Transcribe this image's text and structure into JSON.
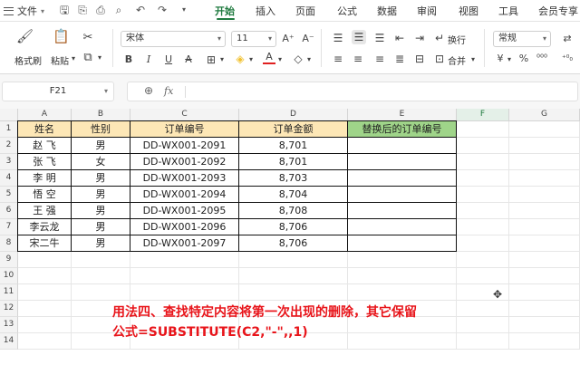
{
  "menubar": {
    "file_label": "文件",
    "tabs": [
      {
        "label": "开始",
        "active": true
      },
      {
        "label": "插入",
        "active": false
      },
      {
        "label": "页面",
        "active": false
      },
      {
        "label": "公式",
        "active": false
      },
      {
        "label": "数据",
        "active": false
      },
      {
        "label": "审阅",
        "active": false
      },
      {
        "label": "视图",
        "active": false
      },
      {
        "label": "工具",
        "active": false
      },
      {
        "label": "会员专享",
        "active": false
      }
    ],
    "accent_color": "#1f7a3f"
  },
  "ribbon": {
    "format_painter_label": "格式刷",
    "paste_label": "粘贴",
    "font_name": "宋体",
    "font_size": "11",
    "wrap_label": "换行",
    "merge_label": "合并",
    "number_format": "常规"
  },
  "formula_bar": {
    "name_box": "F21",
    "fx_label": "fx",
    "formula": ""
  },
  "sheet": {
    "columns": [
      "A",
      "B",
      "C",
      "D",
      "E",
      "F",
      "G"
    ],
    "selected_column": "F",
    "rows": [
      "1",
      "2",
      "3",
      "4",
      "5",
      "6",
      "7",
      "8",
      "9",
      "10",
      "11",
      "12",
      "13",
      "14"
    ],
    "table_headers": [
      "姓名",
      "性别",
      "订单编号",
      "订单金额",
      "替换后的订单编号"
    ],
    "table_rows": [
      [
        "赵  飞",
        "男",
        "DD-WX001-2091",
        "8,701",
        ""
      ],
      [
        "张  飞",
        "女",
        "DD-WX001-2092",
        "8,701",
        ""
      ],
      [
        "李  明",
        "男",
        "DD-WX001-2093",
        "8,703",
        ""
      ],
      [
        "悟  空",
        "男",
        "DD-WX001-2094",
        "8,704",
        ""
      ],
      [
        "王  强",
        "男",
        "DD-WX001-2095",
        "8,708",
        ""
      ],
      [
        "李云龙",
        "男",
        "DD-WX001-2096",
        "8,706",
        ""
      ],
      [
        "宋二牛",
        "男",
        "DD-WX001-2097",
        "8,706",
        ""
      ]
    ],
    "header_fill": "#fde7b6",
    "header_fill_green": "#9fd489"
  },
  "annotation": {
    "line1": "用法四、查找特定内容将第一次出现的删除，其它保留",
    "line2": "公式=SUBSTITUTE(C2,\"-\",,1)",
    "color": "#e8141a"
  }
}
